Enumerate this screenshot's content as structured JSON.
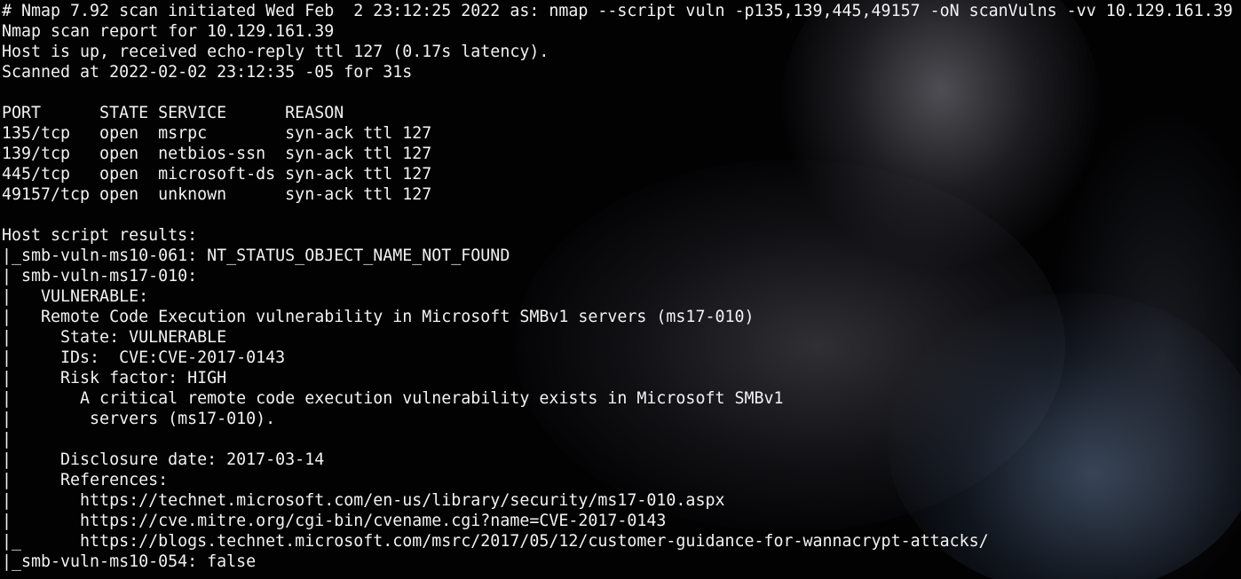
{
  "terminal": {
    "lines": [
      "# Nmap 7.92 scan initiated Wed Feb  2 23:12:25 2022 as: nmap --script vuln -p135,139,445,49157 -oN scanVulns -vv 10.129.161.39",
      "Nmap scan report for 10.129.161.39",
      "Host is up, received echo-reply ttl 127 (0.17s latency).",
      "Scanned at 2022-02-02 23:12:35 -05 for 31s",
      "",
      "PORT      STATE SERVICE      REASON",
      "135/tcp   open  msrpc        syn-ack ttl 127",
      "139/tcp   open  netbios-ssn  syn-ack ttl 127",
      "445/tcp   open  microsoft-ds syn-ack ttl 127",
      "49157/tcp open  unknown      syn-ack ttl 127",
      "",
      "Host script results:",
      "|_smb-vuln-ms10-061: NT_STATUS_OBJECT_NAME_NOT_FOUND",
      "| smb-vuln-ms17-010:",
      "|   VULNERABLE:",
      "|   Remote Code Execution vulnerability in Microsoft SMBv1 servers (ms17-010)",
      "|     State: VULNERABLE",
      "|     IDs:  CVE:CVE-2017-0143",
      "|     Risk factor: HIGH",
      "|       A critical remote code execution vulnerability exists in Microsoft SMBv1",
      "|        servers (ms17-010).",
      "|",
      "|     Disclosure date: 2017-03-14",
      "|     References:",
      "|       https://technet.microsoft.com/en-us/library/security/ms17-010.aspx",
      "|       https://cve.mitre.org/cgi-bin/cvename.cgi?name=CVE-2017-0143",
      "|_      https://blogs.technet.microsoft.com/msrc/2017/05/12/customer-guidance-for-wannacrypt-attacks/",
      "|_smb-vuln-ms10-054: false"
    ]
  }
}
